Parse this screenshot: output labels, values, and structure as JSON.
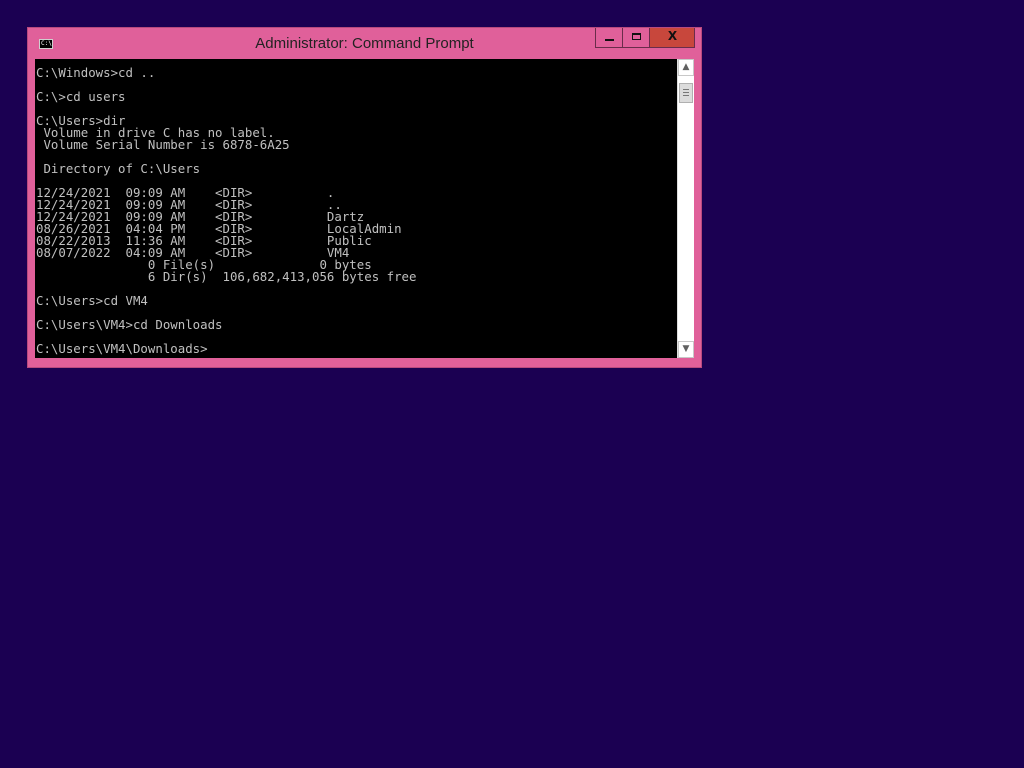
{
  "window": {
    "title": "Administrator: Command Prompt",
    "icon": "cmd-icon",
    "icon_text": "C:\\.",
    "controls": {
      "minimize_icon": "minimize-icon",
      "maximize_icon": "maximize-icon",
      "close_glyph": "X"
    },
    "accent_color": "#e0609a",
    "close_color": "#c8473c"
  },
  "desktop": {
    "background_color": "#1b0052"
  },
  "console": {
    "lines": [
      "C:\\Windows>cd ..",
      "",
      "C:\\>cd users",
      "",
      "C:\\Users>dir",
      " Volume in drive C has no label.",
      " Volume Serial Number is 6878-6A25",
      "",
      " Directory of C:\\Users",
      "",
      "12/24/2021  09:09 AM    <DIR>          .",
      "12/24/2021  09:09 AM    <DIR>          ..",
      "12/24/2021  09:09 AM    <DIR>          Dartz",
      "08/26/2021  04:04 PM    <DIR>          LocalAdmin",
      "08/22/2013  11:36 AM    <DIR>          Public",
      "08/07/2022  04:09 AM    <DIR>          VM4",
      "               0 File(s)              0 bytes",
      "               6 Dir(s)  106,682,413,056 bytes free",
      "",
      "C:\\Users>cd VM4",
      "",
      "C:\\Users\\VM4>cd Downloads",
      "",
      "C:\\Users\\VM4\\Downloads>"
    ]
  },
  "scrollbar": {
    "up_glyph": "▲",
    "down_glyph": "▼",
    "position_fraction": 0.0
  }
}
